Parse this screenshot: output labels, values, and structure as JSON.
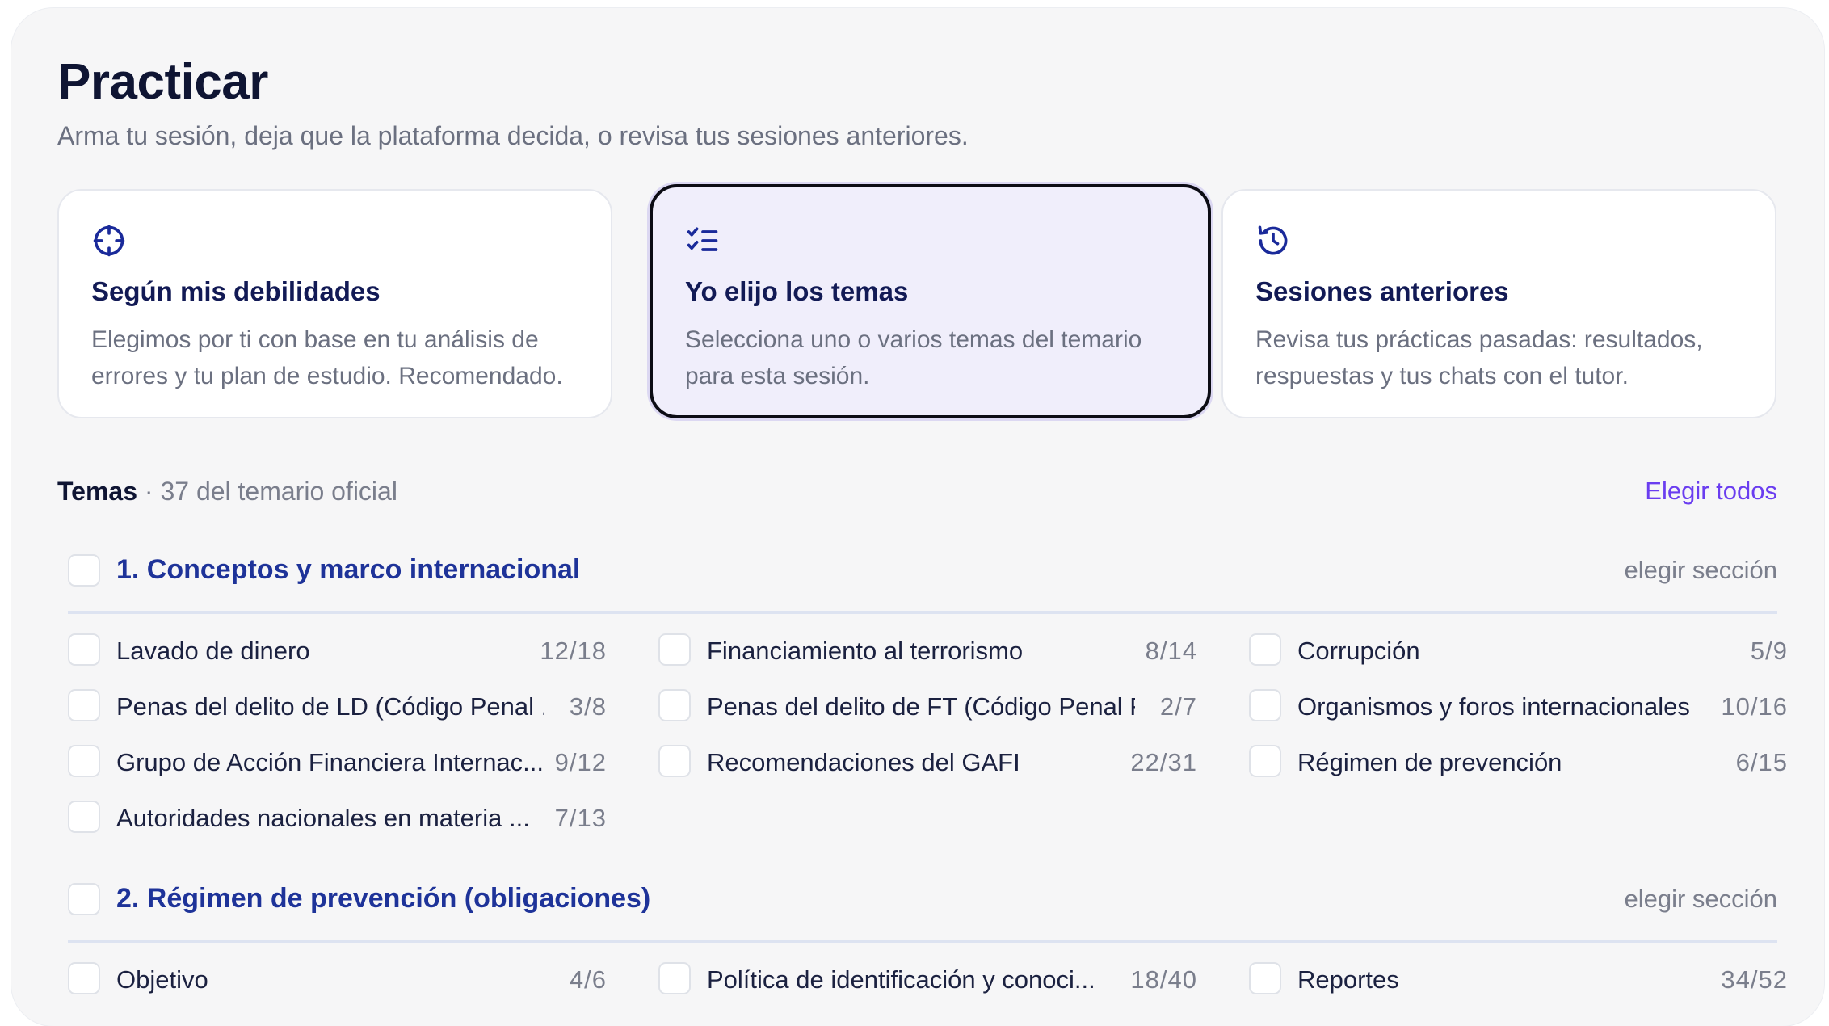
{
  "page": {
    "title": "Practicar",
    "subtitle": "Arma tu sesión, deja que la plataforma decida, o revisa tus sesiones anteriores."
  },
  "modes": [
    {
      "icon": "crosshair-icon",
      "title": "Según mis debilidades",
      "description": "Elegimos por ti con base en tu análisis de errores y tu plan de estudio. Recomendado."
    },
    {
      "icon": "checklist-icon",
      "title": "Yo elijo los temas",
      "description": "Selecciona uno o varios temas del temario para esta sesión.",
      "selected": true
    },
    {
      "icon": "history-icon",
      "title": "Sesiones anteriores",
      "description": "Revisa tus prácticas pasadas: resultados, respuestas y tus chats con el tutor."
    }
  ],
  "topics_header": {
    "label": "Temas",
    "count": " · 37 del temario oficial",
    "select_all": "Elegir todos"
  },
  "sections": [
    {
      "title": "1. Conceptos y marco internacional",
      "pick_label": "elegir sección",
      "topics": [
        {
          "name": "Lavado de dinero",
          "score": "12/18"
        },
        {
          "name": "Financiamiento al terrorismo",
          "score": "8/14"
        },
        {
          "name": "Corrupción",
          "score": "5/9"
        },
        {
          "name": "Penas del delito de LD (Código Penal ...",
          "score": "3/8"
        },
        {
          "name": "Penas del delito de FT (Código Penal F...",
          "score": "2/7"
        },
        {
          "name": "Organismos y foros internacionales",
          "score": "10/16"
        },
        {
          "name": "Grupo de Acción Financiera Internac...",
          "score": "9/12"
        },
        {
          "name": "Recomendaciones del GAFI",
          "score": "22/31"
        },
        {
          "name": "Régimen de prevención",
          "score": "6/15"
        },
        {
          "name": "Autoridades nacionales en materia ...",
          "score": "7/13"
        }
      ]
    },
    {
      "title": "2. Régimen de prevención (obligaciones)",
      "pick_label": "elegir sección",
      "topics": [
        {
          "name": "Objetivo",
          "score": "4/6"
        },
        {
          "name": "Política de identificación y conoci...",
          "score": "18/40"
        },
        {
          "name": "Reportes",
          "score": "34/52"
        }
      ]
    }
  ],
  "colors": {
    "accent": "#6a3df0",
    "title": "#121a55",
    "section_title": "#1e3399",
    "icon": "#1a2a9a"
  }
}
